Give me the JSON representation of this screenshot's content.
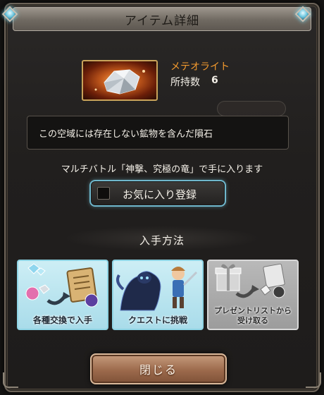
{
  "dialog": {
    "title": "アイテム詳細"
  },
  "item": {
    "name": "メテオライト",
    "count_label": "所持数",
    "count_value": "6",
    "description": "この空域には存在しない鉱物を含んだ隕石",
    "source_note": "マルチバトル「神撃、究極の竜」で手に入ります",
    "thumbnail_icon": "meteorite-crystal-icon"
  },
  "favorite": {
    "label": "お気に入り登録",
    "checked": false
  },
  "acquisition": {
    "title": "入手方法",
    "methods": [
      {
        "label": "各種交換で入手",
        "icon": "exchange-icon",
        "enabled": true
      },
      {
        "label": "クエストに挑戦",
        "icon": "quest-characters-icon",
        "enabled": true
      },
      {
        "label": "プレゼントリストから受け取る",
        "label_line1": "プレゼントリストから",
        "label_line2": "受け取る",
        "icon": "gift-icon",
        "enabled": false
      }
    ]
  },
  "actions": {
    "close_label": "閉じる"
  },
  "colors": {
    "item_name": "#f39a2e",
    "accent_cyan": "#6fb7cc",
    "card_disabled": "#9c9c9c",
    "close_button": "#9c6a4c"
  }
}
